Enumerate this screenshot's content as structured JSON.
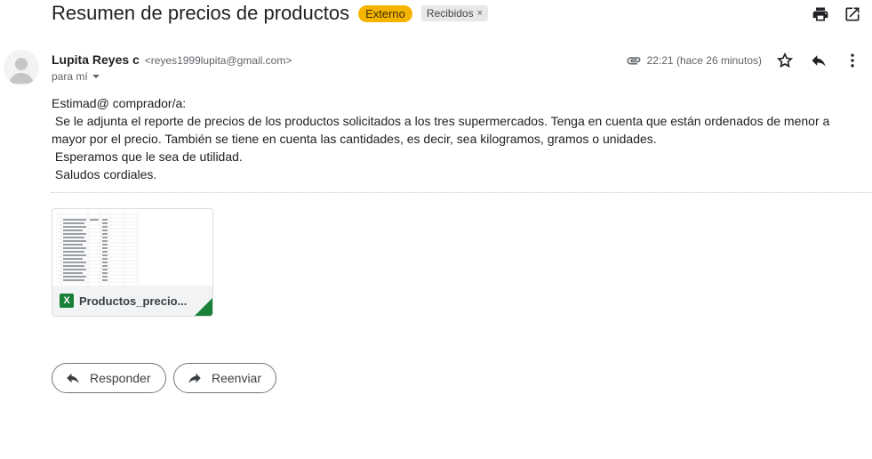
{
  "header": {
    "subject": "Resumen de precios de productos",
    "external_chip": "Externo",
    "label_chip": "Recibidos",
    "label_chip_close": "×",
    "icons": [
      "print-icon",
      "open-in-new-window-icon"
    ]
  },
  "sender": {
    "name": "Lupita Reyes c",
    "email": "<reyes1999lupita@gmail.com>",
    "to": "para mí"
  },
  "meta": {
    "time": "22:21 (hace 26 minutos)",
    "icons": [
      "attachment-icon",
      "star-icon",
      "reply-icon",
      "more-vert-icon"
    ]
  },
  "body": {
    "greeting": "Estimad@ comprador/a:",
    "line1": " Se le adjunta el reporte de precios de los productos solicitados a los tres supermercados. Tenga en cuenta que están ordenados de menor a mayor por el precio. También se tiene en cuenta las cantidades, es decir, sea kilogramos, gramos o unidades.",
    "line2": " Esperamos que le sea de utilidad.",
    "line3": " Saludos cordiales."
  },
  "attachment": {
    "name": "Productos_precio...",
    "icon_letter": "X"
  },
  "actions": {
    "reply_label": "Responder",
    "forward_label": "Reenviar"
  },
  "colors": {
    "external_chip": "#f5b400",
    "excel_green": "#188038"
  }
}
